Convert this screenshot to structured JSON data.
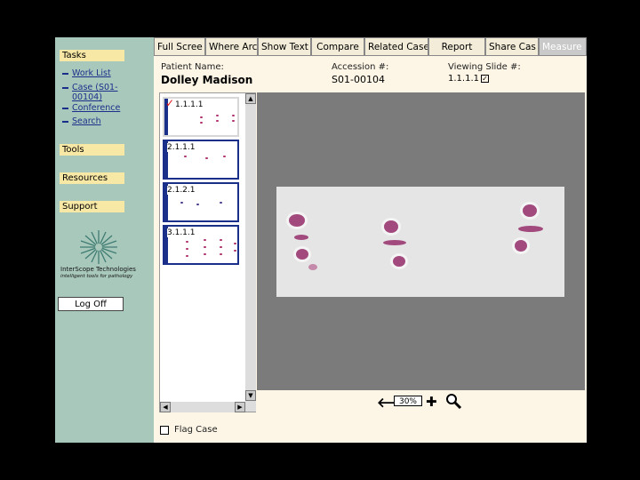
{
  "sidebar": {
    "tasks_header": "Tasks",
    "links": [
      "Work List",
      "Case (S01-00104)",
      "Conference",
      "Search"
    ],
    "tools_header": "Tools",
    "resources_header": "Resources",
    "support_header": "Support",
    "company_name": "InterScope Technologies",
    "company_tagline": "intelligent tools for pathology",
    "logoff_label": "Log Off"
  },
  "toolbar": {
    "buttons": [
      "Full Scree",
      "Where Arc",
      "Show Text",
      "Compare",
      "Related Case",
      "Report",
      "Share Cas",
      "Measure"
    ]
  },
  "patient": {
    "name_label": "Patient Name:",
    "name": "Dolley Madison",
    "accession_label": "Accession #:",
    "accession": "S01-00104",
    "slide_label": "Viewing Slide #:",
    "slide": "1.1.1.1"
  },
  "thumbnails": [
    {
      "label": "1.1.1.1",
      "selected": true
    },
    {
      "label": "2.1.1.1",
      "selected": false
    },
    {
      "label": "2.1.2.1",
      "selected": false
    },
    {
      "label": "3.1.1.1",
      "selected": false
    }
  ],
  "zoom": {
    "level": "30%"
  },
  "flag": {
    "label": "Flag Case",
    "checked": false
  },
  "colors": {
    "sidebar": "#a9c8bc",
    "header_bg": "#f7e8a5",
    "viewer_bg": "#7b7b7b",
    "tissue": "#a24a7e",
    "selection_border": "#1a2f8a"
  }
}
